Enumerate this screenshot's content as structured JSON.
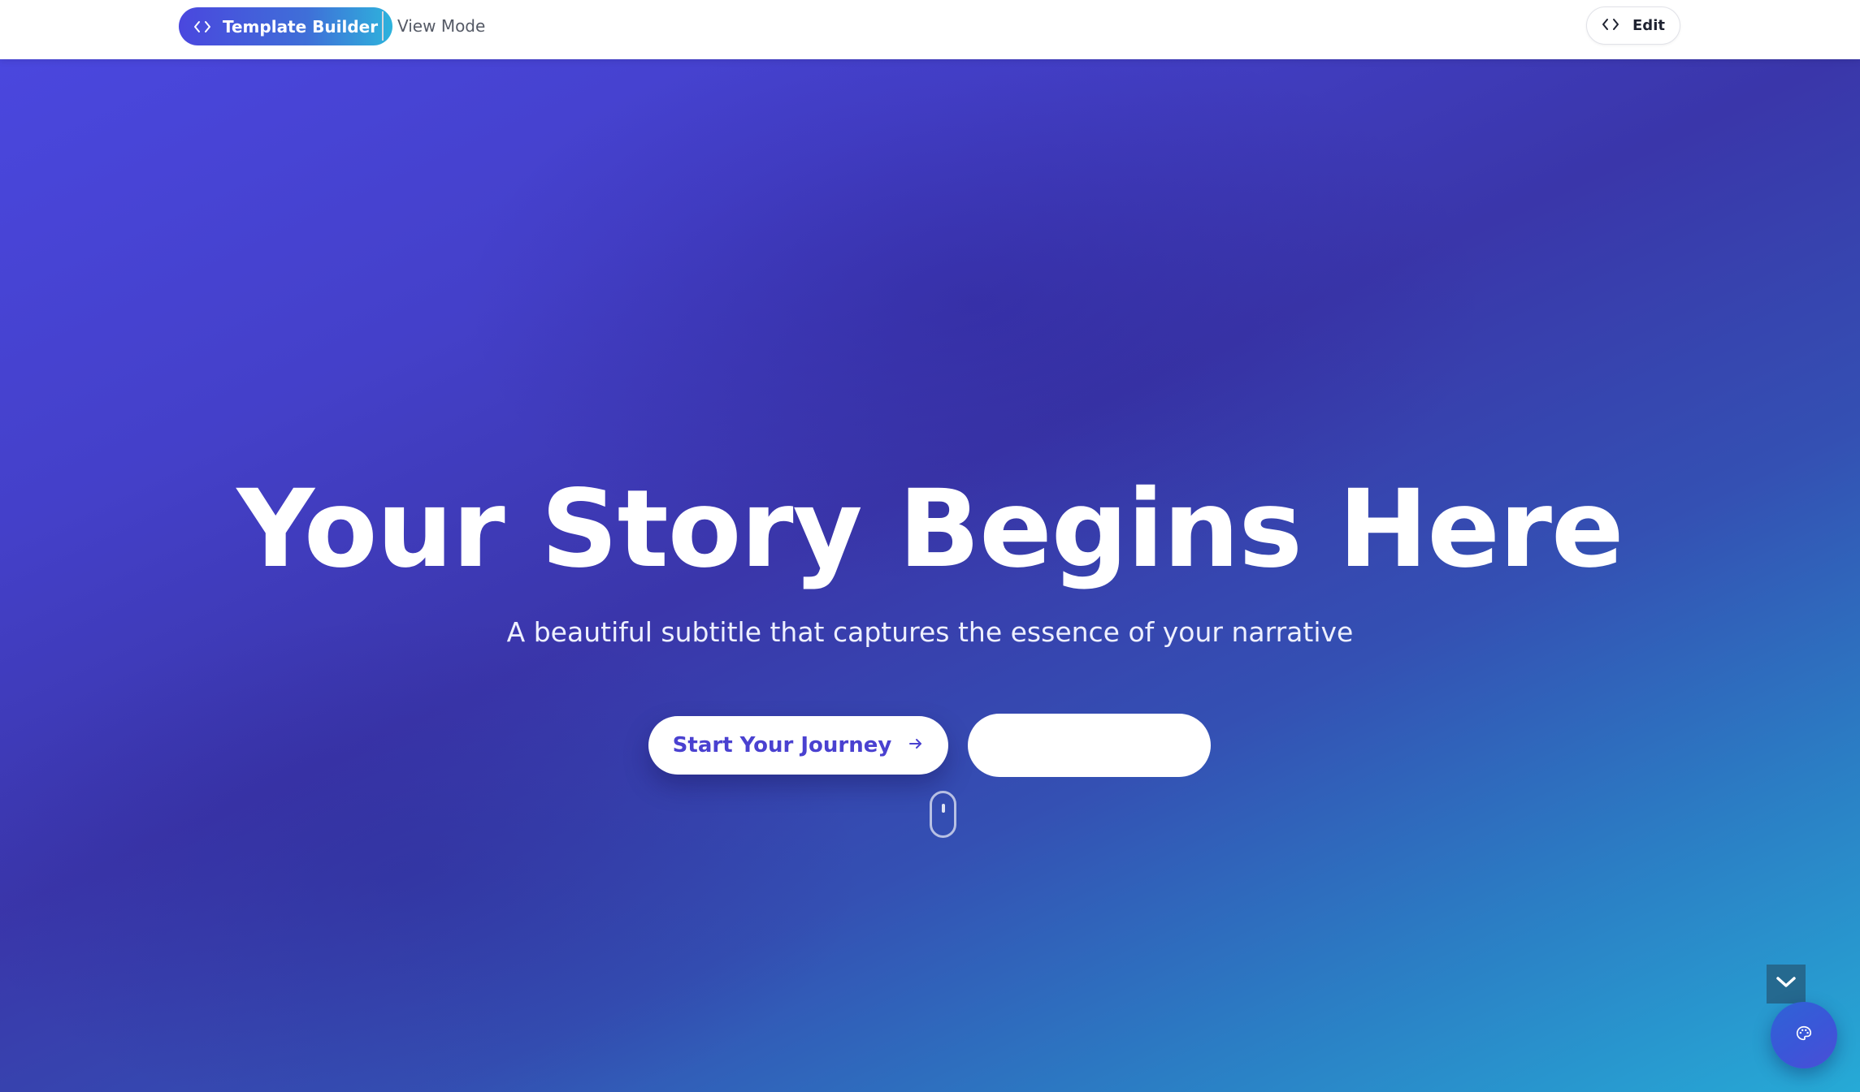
{
  "header": {
    "brand_label": "Template Builder",
    "mode_label": "View Mode",
    "edit_label": "Edit"
  },
  "hero": {
    "title": "Your Story Begins Here",
    "subtitle": "A beautiful subtitle that captures the essence of your narrative",
    "primary_cta_label": "Start Your Journey",
    "secondary_cta_label": ""
  },
  "icons": {
    "brand": "code-icon",
    "edit": "code-icon",
    "primary_cta": "arrow-right-icon",
    "scroll": "mouse-scroll-icon",
    "collapse": "chevron-down-icon",
    "theme": "palette-icon"
  },
  "colors": {
    "brand_gradient_start": "#4a47de",
    "brand_gradient_end": "#2eb3dc",
    "primary_cta_text": "#4a41d0",
    "hero_gradient_start": "#4a47de",
    "hero_gradient_end": "#26aad6"
  }
}
